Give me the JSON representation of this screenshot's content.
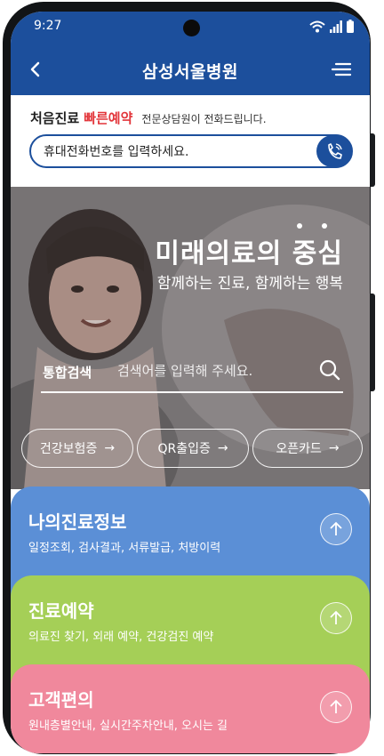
{
  "status_bar": {
    "time": "9:27"
  },
  "app_bar": {
    "title": "삼성서울병원"
  },
  "quick_booking": {
    "label": "처음진료",
    "accent": "빠른예약",
    "note": "전문상담원이 전화드립니다.",
    "phone_placeholder": "휴대전화번호를 입력하세요."
  },
  "hero": {
    "headline": "미래의료의 중심",
    "subline": "함께하는 진료, 함께하는 행복"
  },
  "search": {
    "label": "통합검색",
    "placeholder": "검색어를 입력해 주세요."
  },
  "chips": [
    {
      "label": "건강보험증",
      "arrow": "→"
    },
    {
      "label": "QR출입증",
      "arrow": "→"
    },
    {
      "label": "오픈카드",
      "arrow": "→"
    }
  ],
  "cards": [
    {
      "title": "나의진료정보",
      "subtitle": "일정조회, 검사결과, 서류발급, 처방이력",
      "color": "#5b8fd6"
    },
    {
      "title": "진료예약",
      "subtitle": "의료진 찾기, 외래 예약, 건강검진 예약",
      "color": "#a5cf57"
    },
    {
      "title": "고객편의",
      "subtitle": "원내층별안내, 실시간주차안내, 오시는 길",
      "color": "#f0889c"
    }
  ],
  "colors": {
    "brand_blue": "#1c4f9c",
    "accent_red": "#e2353a"
  },
  "icons": {
    "back": "chevron-left-icon",
    "menu": "menu-icon",
    "call": "phone-icon",
    "search": "search-icon",
    "card_arrow": "arrow-up-icon"
  }
}
